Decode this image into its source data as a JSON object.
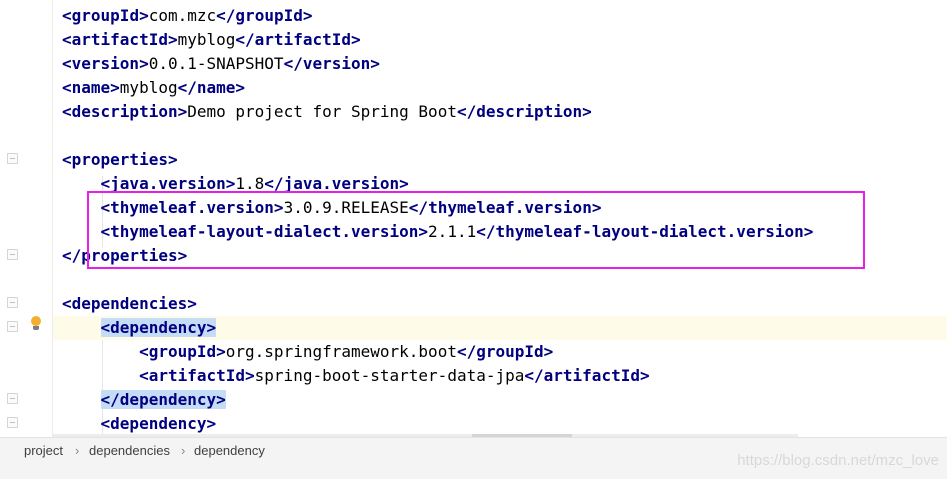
{
  "editor": {
    "lines": [
      {
        "parts": [
          {
            "t": "<",
            "c": "tag"
          },
          {
            "t": "groupId",
            "c": "tag"
          },
          {
            "t": ">",
            "c": "tag"
          },
          {
            "t": "com.mzc"
          },
          {
            "t": "</",
            "c": "tag"
          },
          {
            "t": "groupId",
            "c": "tag"
          },
          {
            "t": ">",
            "c": "tag"
          }
        ]
      },
      {
        "parts": [
          {
            "t": "<artifactId>",
            "c": "tag"
          },
          {
            "t": "myblog"
          },
          {
            "t": "</artifactId>",
            "c": "tag"
          }
        ]
      },
      {
        "parts": [
          {
            "t": "<version>",
            "c": "tag"
          },
          {
            "t": "0.0.1-SNAPSHOT"
          },
          {
            "t": "</version>",
            "c": "tag"
          }
        ]
      },
      {
        "parts": [
          {
            "t": "<name>",
            "c": "tag"
          },
          {
            "t": "myblog"
          },
          {
            "t": "</name>",
            "c": "tag"
          }
        ]
      },
      {
        "parts": [
          {
            "t": "<description>",
            "c": "tag"
          },
          {
            "t": "Demo project for Spring Boot"
          },
          {
            "t": "</description>",
            "c": "tag"
          }
        ]
      },
      {
        "parts": []
      },
      {
        "parts": [
          {
            "t": "<properties>",
            "c": "tag"
          }
        ]
      },
      {
        "parts": [
          {
            "t": "    "
          },
          {
            "t": "<java.version>",
            "c": "tag"
          },
          {
            "t": "1.8"
          },
          {
            "t": "</java.version>",
            "c": "tag"
          }
        ]
      },
      {
        "parts": [
          {
            "t": "    "
          },
          {
            "t": "<thymeleaf.version>",
            "c": "tag"
          },
          {
            "t": "3.0.9.RELEASE"
          },
          {
            "t": "</thymeleaf.version>",
            "c": "tag"
          }
        ]
      },
      {
        "parts": [
          {
            "t": "    "
          },
          {
            "t": "<thymeleaf-layout-dialect.version>",
            "c": "tag"
          },
          {
            "t": "2.1.1"
          },
          {
            "t": "</thymeleaf-layout-dialect.version>",
            "c": "tag"
          }
        ]
      },
      {
        "parts": [
          {
            "t": "</properties>",
            "c": "tag"
          }
        ]
      },
      {
        "parts": []
      },
      {
        "parts": [
          {
            "t": "<dependencies>",
            "c": "tag"
          }
        ]
      },
      {
        "parts": [
          {
            "t": "    "
          },
          {
            "t": "<dependency>",
            "c": "tag sel"
          }
        ]
      },
      {
        "parts": [
          {
            "t": "        "
          },
          {
            "t": "<groupId>",
            "c": "tag"
          },
          {
            "t": "org.springframework.boot"
          },
          {
            "t": "</groupId>",
            "c": "tag"
          }
        ]
      },
      {
        "parts": [
          {
            "t": "        "
          },
          {
            "t": "<artifactId>",
            "c": "tag"
          },
          {
            "t": "spring-boot-starter-data-jpa"
          },
          {
            "t": "</artifactId>",
            "c": "tag"
          }
        ]
      },
      {
        "parts": [
          {
            "t": "    "
          },
          {
            "t": "</dependency>",
            "c": "tag sel"
          }
        ]
      },
      {
        "parts": [
          {
            "t": "    "
          },
          {
            "t": "<dependency>",
            "c": "tag"
          }
        ]
      }
    ],
    "caret_line_index": 13
  },
  "breadcrumb": {
    "items": [
      "project",
      "dependencies",
      "dependency"
    ]
  },
  "watermark": "https://blog.csdn.net/mzc_love",
  "colors": {
    "tag": "#000080",
    "selection": "#c4dcf6",
    "highlight_box": "#e51fe5",
    "caret_line": "#fefce8",
    "bulb": "#f2b02e"
  }
}
